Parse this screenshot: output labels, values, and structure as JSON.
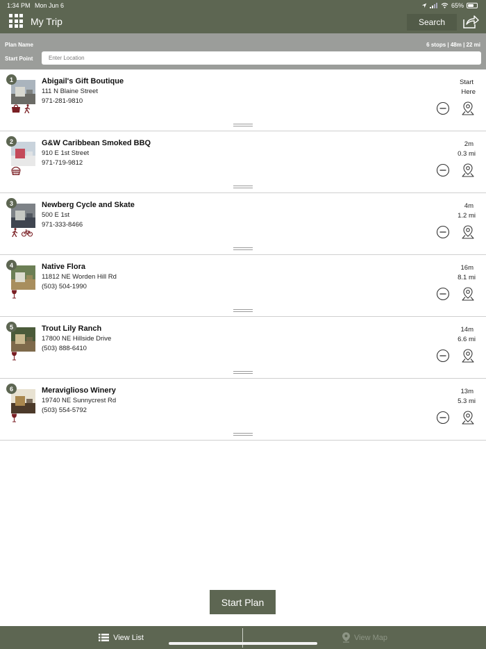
{
  "status": {
    "time": "1:34 PM",
    "date": "Mon Jun 6",
    "battery": "65%",
    "battery_level": 0.65
  },
  "header": {
    "title": "My Trip",
    "search_label": "Search"
  },
  "plan": {
    "name_label": "Plan Name",
    "summary": "6 stops | 48m | 22 mi",
    "start_label": "Start Point",
    "start_placeholder": "Enter Location",
    "start_value": ""
  },
  "stops": [
    {
      "num": "1",
      "name": "Abigail's Gift Boutique",
      "address": "111 N Blaine Street",
      "phone": "971-281-9810",
      "time": "Start",
      "distance": "Here",
      "categories": [
        "shopping-bag-icon",
        "walking-icon"
      ]
    },
    {
      "num": "2",
      "name": "G&W Caribbean Smoked BBQ",
      "address": "910 E 1st Street",
      "phone": "971-719-9812",
      "time": "2m",
      "distance": "0.3 mi",
      "categories": [
        "food-basket-icon"
      ]
    },
    {
      "num": "3",
      "name": "Newberg Cycle and Skate",
      "address": "500 E 1st",
      "phone": "971-333-8466",
      "time": "4m",
      "distance": "1.2 mi",
      "categories": [
        "walking-icon",
        "bicycle-icon"
      ]
    },
    {
      "num": "4",
      "name": "Native Flora",
      "address": "11812 NE Worden Hill Rd",
      "phone": "(503) 504-1990",
      "time": "16m",
      "distance": "8.1 mi",
      "categories": [
        "wine-glass-icon"
      ]
    },
    {
      "num": "5",
      "name": "Trout Lily Ranch",
      "address": "17800 NE Hillside Drive",
      "phone": "(503) 888-6410",
      "time": "14m",
      "distance": "6.6 mi",
      "categories": [
        "wine-glass-icon"
      ]
    },
    {
      "num": "6",
      "name": "Meraviglioso Winery",
      "address": "19740 NE Sunnycrest Rd",
      "phone": "(503) 554-5792",
      "time": "13m",
      "distance": "5.3 mi",
      "categories": [
        "wine-glass-icon"
      ]
    }
  ],
  "start_plan_label": "Start Plan",
  "tabs": {
    "list_label": "View List",
    "map_label": "View Map"
  },
  "colors": {
    "brand": "#5d6652",
    "plan_bar": "#9b9d9a",
    "category_icon": "#7a1f24"
  }
}
